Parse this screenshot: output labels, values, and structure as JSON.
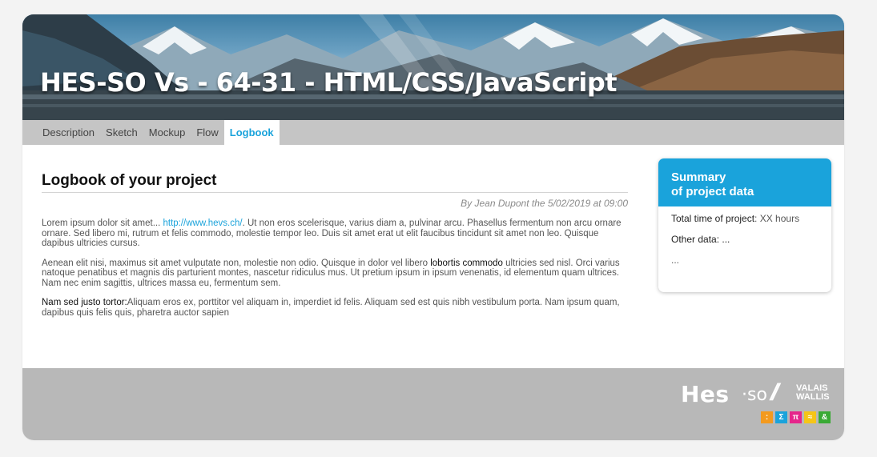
{
  "header": {
    "title": "HES-SO Vs - 64-31 - HTML/CSS/JavaScript"
  },
  "tabs": [
    {
      "label": "Description"
    },
    {
      "label": "Sketch"
    },
    {
      "label": "Mockup"
    },
    {
      "label": "Flow"
    },
    {
      "label": "Logbook",
      "active": true
    }
  ],
  "main": {
    "title": "Logbook of your project",
    "byline": "By Jean Dupont the 5/02/2019 at 09:00",
    "p1_before": "Lorem ipsum dolor sit amet... ",
    "p1_link": "http://www.hevs.ch/",
    "p1_after": ". Ut non eros scelerisque, varius diam a, pulvinar arcu. Phasellus fermentum non arcu ornare ornare. Sed libero mi, rutrum et felis commodo, molestie tempor leo. Duis sit amet erat ut elit faucibus tincidunt sit amet non leo. Quisque dapibus ultricies cursus.",
    "p2_before": "Aenean elit nisi, maximus sit amet vulputate non, molestie non odio. Quisque in dolor vel libero ",
    "p2_bold": "lobortis commodo",
    "p2_after": " ultricies sed nisl. Orci varius natoque penatibus et magnis dis parturient montes, nascetur ridiculus mus. Ut pretium ipsum in ipsum venenatis, id elementum quam ultrices. Nam nec enim sagittis, ultrices massa eu, fermentum sem.",
    "p3_bold": "Nam sed justo tortor:",
    "p3_after": "Aliquam eros ex, porttitor vel aliquam in, imperdiet id felis. Aliquam sed est quis nibh vestibulum porta. Nam ipsum quam, dapibus quis felis quis, pharetra auctor sapien"
  },
  "summary": {
    "title_line1": "Summary",
    "title_line2": "of project data",
    "total_label": "Total time of project",
    "total_value": ": XX hours",
    "other_label": "Other data: ...",
    "more": "..."
  },
  "footer": {
    "logo_hes": "Hes",
    "logo_so": "·so",
    "logo_valais": "VALAIS",
    "logo_wallis": "WALLIS",
    "badges": [
      {
        "glyph": ":",
        "color": "#f39a1f"
      },
      {
        "glyph": "Σ",
        "color": "#1aa3db"
      },
      {
        "glyph": "π",
        "color": "#e5258b"
      },
      {
        "glyph": "≈",
        "color": "#f5c518"
      },
      {
        "glyph": "&",
        "color": "#3aaa35"
      }
    ]
  },
  "colors": {
    "accent": "#1aa3db",
    "tabbar": "#c5c5c5",
    "footer": "#b8b8b8"
  }
}
